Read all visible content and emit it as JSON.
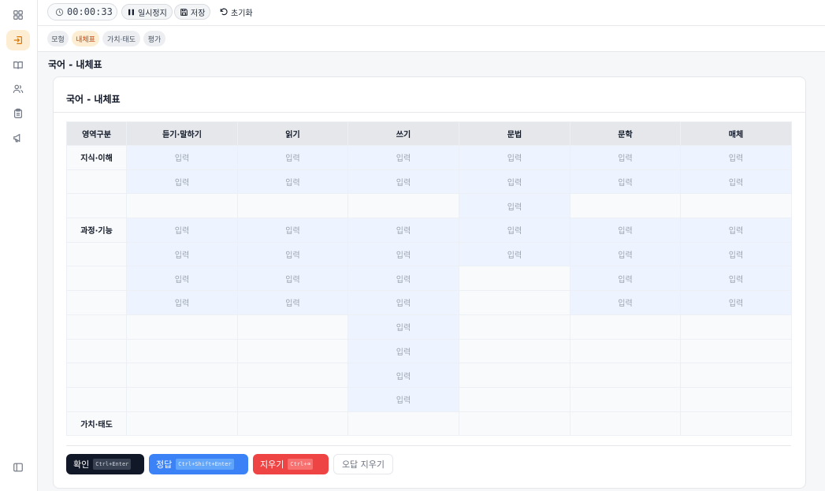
{
  "toolbar": {
    "timer": "00:00:33",
    "pause_label": "일시정지",
    "save_label": "저장",
    "reset_label": "초기화"
  },
  "tabs": [
    {
      "label": "모형",
      "active": false
    },
    {
      "label": "내체표",
      "active": true
    },
    {
      "label": "가치·태도",
      "active": false
    },
    {
      "label": "평가",
      "active": false
    }
  ],
  "page_title": "국어 - 내체표",
  "card_title": "국어 - 내체표",
  "table": {
    "columns": [
      "영역구분",
      "듣기·말하기",
      "읽기",
      "쓰기",
      "문법",
      "문학",
      "매체"
    ],
    "input_placeholder": "입력",
    "rows": [
      {
        "label": "지식·이해",
        "cells": [
          1,
          1,
          1,
          1,
          1,
          1
        ]
      },
      {
        "label": "",
        "cells": [
          1,
          1,
          1,
          1,
          1,
          1
        ]
      },
      {
        "label": "",
        "cells": [
          0,
          0,
          0,
          1,
          0,
          0
        ]
      },
      {
        "label": "과정·기능",
        "cells": [
          1,
          1,
          1,
          1,
          1,
          1
        ]
      },
      {
        "label": "",
        "cells": [
          1,
          1,
          1,
          1,
          1,
          1
        ]
      },
      {
        "label": "",
        "cells": [
          1,
          1,
          1,
          0,
          1,
          1
        ]
      },
      {
        "label": "",
        "cells": [
          1,
          1,
          1,
          0,
          1,
          1
        ]
      },
      {
        "label": "",
        "cells": [
          0,
          0,
          1,
          0,
          0,
          0
        ]
      },
      {
        "label": "",
        "cells": [
          0,
          0,
          1,
          0,
          0,
          0
        ]
      },
      {
        "label": "",
        "cells": [
          0,
          0,
          1,
          0,
          0,
          0
        ]
      },
      {
        "label": "",
        "cells": [
          0,
          0,
          1,
          0,
          0,
          0
        ]
      },
      {
        "label": "가치·태도",
        "cells": [
          0,
          0,
          0,
          0,
          0,
          0
        ]
      }
    ]
  },
  "actions": {
    "confirm_label": "확인",
    "confirm_kbd": "Ctrl+Enter",
    "answer_label": "정답",
    "answer_kbd": "Ctrl+Shift+Enter",
    "erase_label": "지우기",
    "erase_kbd": "Ctrl+⌫",
    "wrong_label": "오답 지우기"
  },
  "colors": {
    "accent": "#f59e0b",
    "input_cell": "#eef4ff",
    "confirm": "#111827",
    "answer": "#3b82f6",
    "erase": "#ef4444"
  }
}
